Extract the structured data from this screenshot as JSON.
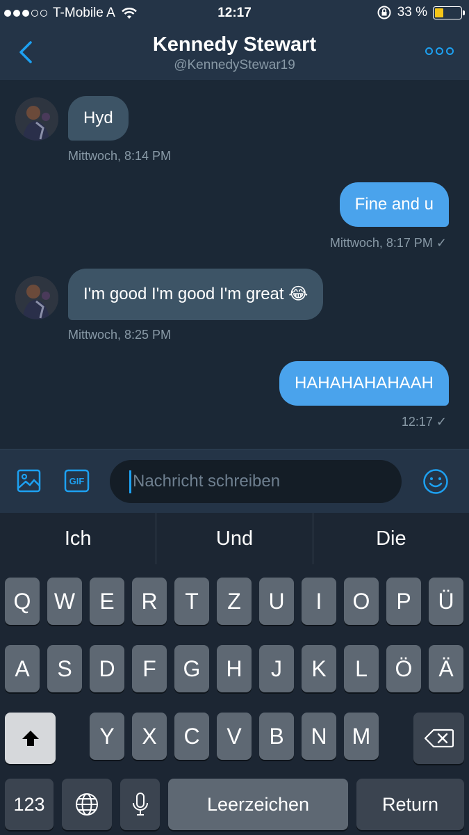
{
  "status_bar": {
    "carrier": "T-Mobile A",
    "time": "12:17",
    "battery_percent": "33 %",
    "battery_level": 0.33
  },
  "header": {
    "title": "Kennedy Stewart",
    "handle": "@KennedyStewar19",
    "back_icon": "chevron-left-icon",
    "more_icon": "more-icon"
  },
  "messages": [
    {
      "direction": "in",
      "text": "Hyd",
      "meta": "Mittwoch, 8:14 PM"
    },
    {
      "direction": "out",
      "text": "Fine and u",
      "meta": "Mittwoch, 8:17 PM ✓"
    },
    {
      "direction": "in",
      "text": "I'm good I'm good I'm great 😂",
      "meta": "Mittwoch, 8:25 PM"
    },
    {
      "direction": "out",
      "text": "HAHAHAHAHAAH",
      "meta": "12:17 ✓"
    }
  ],
  "composer": {
    "placeholder": "Nachricht schreiben",
    "gif_label": "GIF"
  },
  "keyboard": {
    "suggestions": [
      "Ich",
      "Und",
      "Die"
    ],
    "row1": [
      "Q",
      "W",
      "E",
      "R",
      "T",
      "Z",
      "U",
      "I",
      "O",
      "P",
      "Ü"
    ],
    "row2": [
      "A",
      "S",
      "D",
      "F",
      "G",
      "H",
      "J",
      "K",
      "L",
      "Ö",
      "Ä"
    ],
    "row3": [
      "Y",
      "X",
      "C",
      "V",
      "B",
      "N",
      "M"
    ],
    "numbers_label": "123",
    "space_label": "Leerzeichen",
    "return_label": "Return"
  },
  "colors": {
    "accent": "#1da1f2",
    "outgoing_bubble": "#4aa3ec",
    "incoming_bubble": "#3d5466",
    "background": "#1b2836"
  }
}
